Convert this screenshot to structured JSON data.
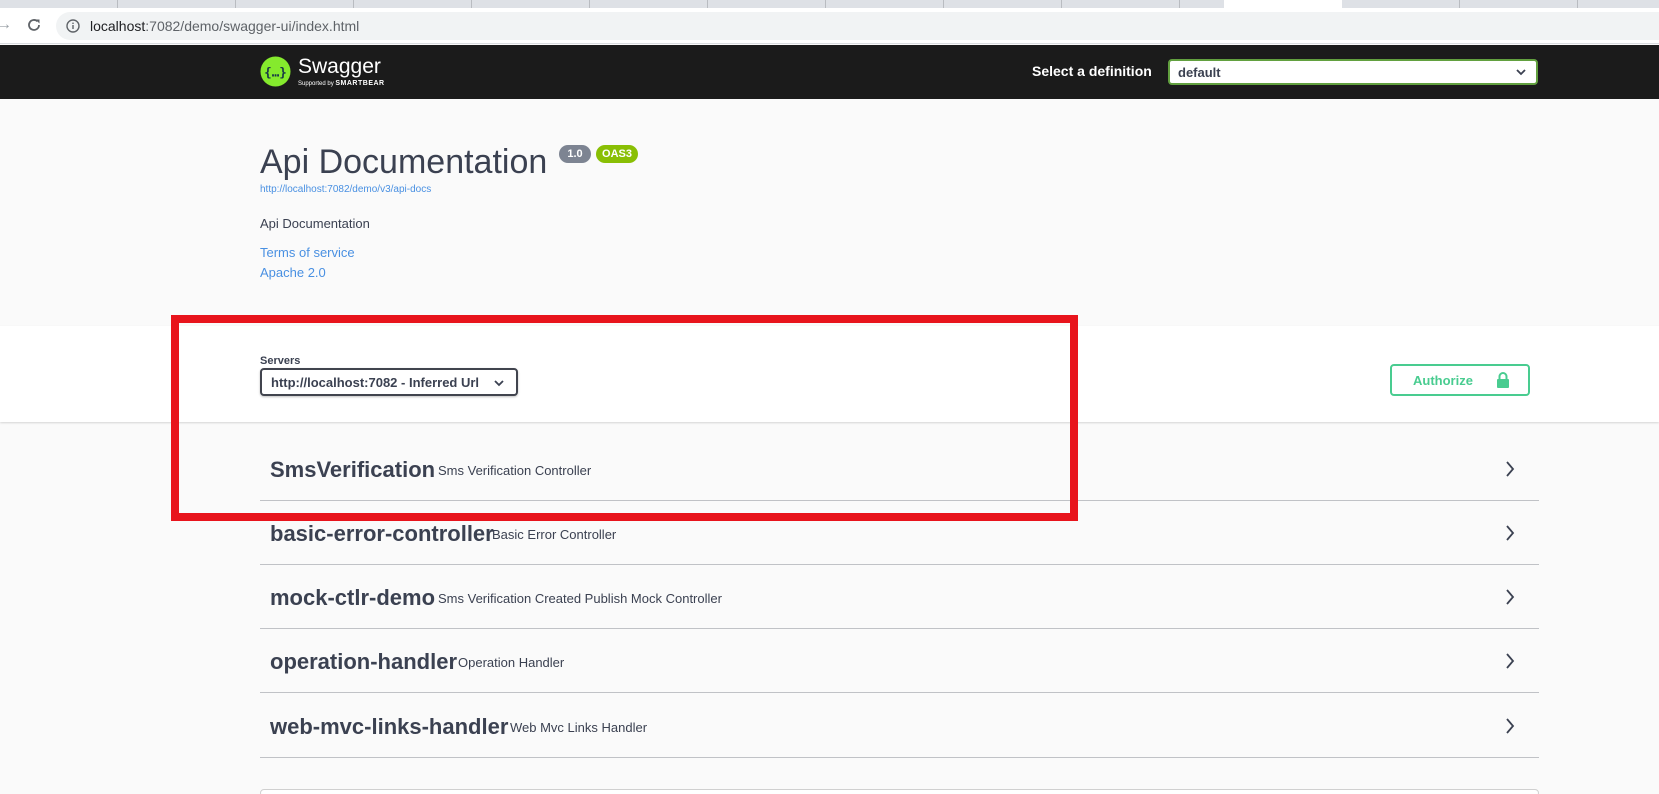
{
  "browser": {
    "url_host": "localhost",
    "url_rest": ":7082/demo/swagger-ui/index.html"
  },
  "topbar": {
    "logo_text": "Swagger",
    "logo_sub_prefix": "Supported by",
    "logo_sub_brand": "SMARTBEAR",
    "definition_label": "Select a definition",
    "definition_value": "default"
  },
  "info": {
    "title": "Api Documentation",
    "version_badge": "1.0",
    "oas_badge": "OAS3",
    "spec_url": "http://localhost:7082/demo/v3/api-docs",
    "description": "Api Documentation",
    "terms_link": "Terms of service",
    "license_link": "Apache 2.0"
  },
  "servers": {
    "label": "Servers",
    "selected": "http://localhost:7082 - Inferred Url"
  },
  "authorize": {
    "label": "Authorize"
  },
  "tags": [
    {
      "name": "SmsVerification",
      "description": "Sms Verification Controller"
    },
    {
      "name": "basic-error-controller",
      "description": "Basic Error Controller"
    },
    {
      "name": "mock-ctlr-demo",
      "description": "Sms Verification Created Publish Mock Controller"
    },
    {
      "name": "operation-handler",
      "description": "Operation Handler"
    },
    {
      "name": "web-mvc-links-handler",
      "description": "Web Mvc Links Handler"
    }
  ],
  "colors": {
    "topbar_bg": "#1b1b1b",
    "logo_green": "#85ea2d",
    "select_border": "#62a03f",
    "link_blue": "#4990e2",
    "authorize_green": "#49cc90",
    "version_badge": "#7d8492",
    "oas_badge": "#89bf04",
    "highlight_red": "#e8141c"
  }
}
